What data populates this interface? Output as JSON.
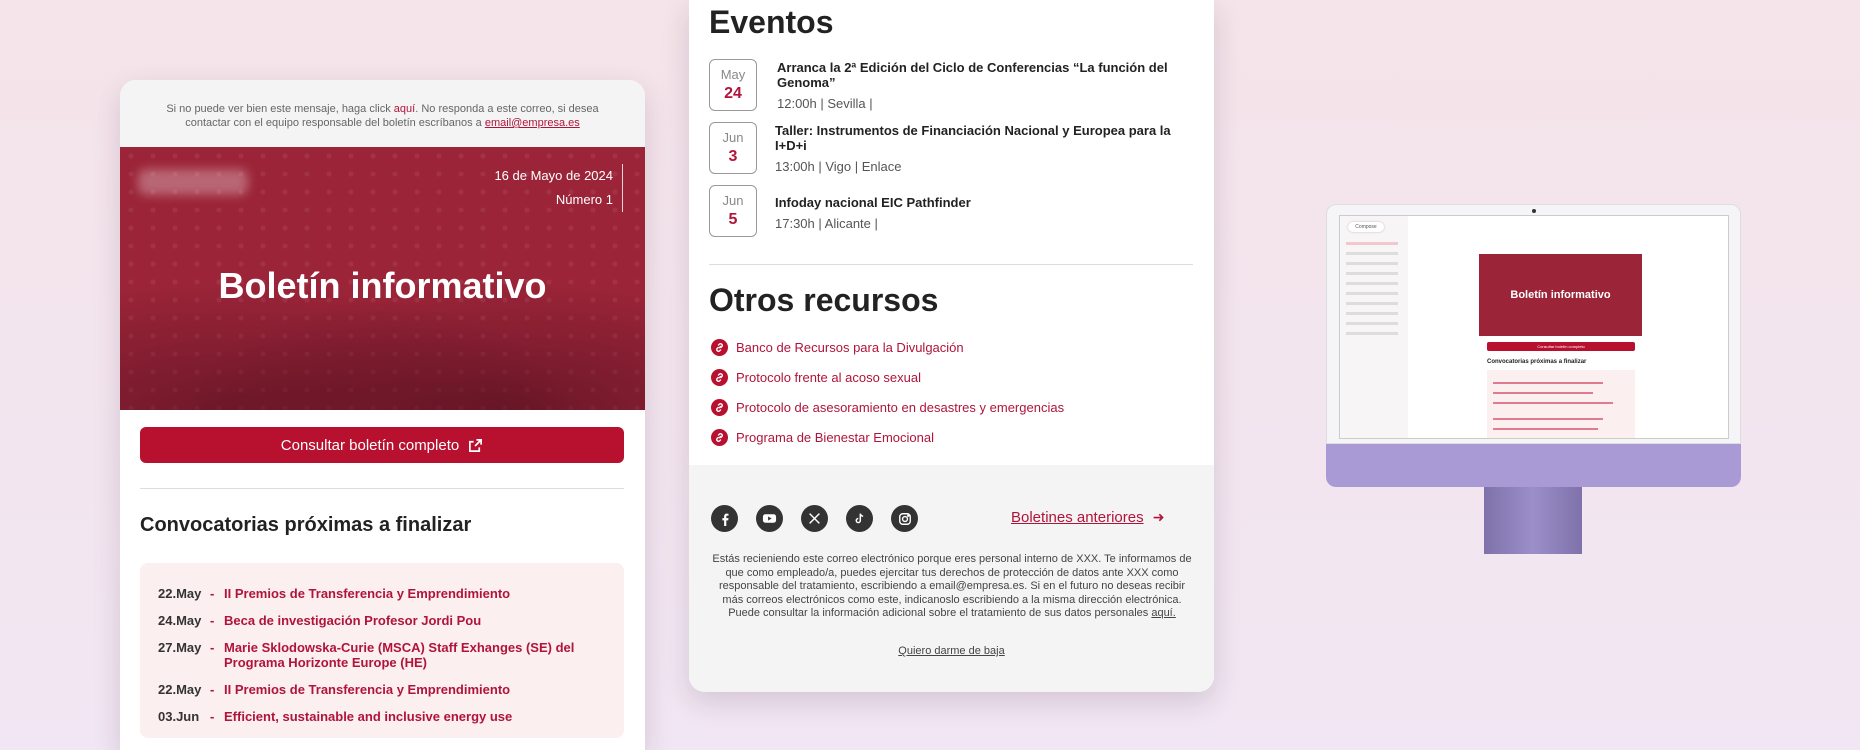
{
  "preheader": {
    "text_1": "Si no puede ver bien este mensaje, haga click ",
    "link_here": "aquí",
    "text_2": ". No responda a este correo, si desea contactar con el equipo responsable del boletín escríbanos a ",
    "email": "email@empresa.es"
  },
  "hero": {
    "date": "16 de Mayo de 2024",
    "number": "Número 1",
    "title": "Boletín informativo"
  },
  "cta": {
    "label": "Consultar boletín completo",
    "icon": "external-link-icon"
  },
  "convocatorias": {
    "heading": "Convocatorias próximas a finalizar",
    "separator": "-",
    "items": [
      {
        "date": "22.May",
        "title": "II Premios de Transferencia y Emprendimiento"
      },
      {
        "date": "24.May",
        "title": "Beca de investigación Profesor Jordi Pou"
      },
      {
        "date": "27.May",
        "title": "Marie Sklodowska-Curie (MSCA) Staff Exhanges (SE) del Programa Horizonte Europe (HE)"
      },
      {
        "date": "22.May",
        "title": "II Premios de Transferencia y Emprendimiento"
      },
      {
        "date": "03.Jun",
        "title": "Efficient, sustainable and inclusive energy use"
      }
    ]
  },
  "eventos": {
    "heading": "Eventos",
    "items": [
      {
        "month": "May",
        "day": "24",
        "title": "Arranca la 2ª Edición del Ciclo de Conferencias “La función del Genoma”",
        "info": "12:00h   |   Sevilla   |"
      },
      {
        "month": "Jun",
        "day": "3",
        "title": "Taller: Instrumentos de Financiación Nacional y Europea para la I+D+i",
        "info": "13:00h   |   Vigo   |   Enlace"
      },
      {
        "month": "Jun",
        "day": "5",
        "title": "Infoday nacional EIC Pathfinder",
        "info": "17:30h   |   Alicante   |"
      }
    ]
  },
  "recursos": {
    "heading": "Otros recursos",
    "icon": "link-icon",
    "items": [
      "Banco de Recursos para la Divulgación",
      "Protocolo frente al acoso sexual",
      "Protocolo de asesoramiento en desastres y emergencias",
      "Programa de Bienestar Emocional"
    ]
  },
  "footer": {
    "social": [
      "facebook-icon",
      "youtube-icon",
      "x-icon",
      "tiktok-icon",
      "instagram-icon"
    ],
    "previous": "Boletines anteriores",
    "legal": "Estás recieniendo este correo electrónico porque eres personal interno de XXX. Te informamos de que como empleado/a, puedes ejercitar tus derechos de protección de datos ante XXX como responsable del tratamiento, escribiendo a email@empresa.es. Si en el futuro no deseas recibir más correos electrónicos como este, indicanoslo escribiendo a la misma dirección electrónica. Puede consultar la información adicional sobre el tratamiento de sus datos personales ",
    "legal_link": "aquí.",
    "unsubscribe": "Quiero darme de baja"
  },
  "monitor": {
    "compose": "Compose",
    "newsletter_title": "Boletín informativo",
    "button": "Consultar boletín completo",
    "heading": "Convocatorias próximas a finalizar"
  },
  "colors": {
    "brand_red": "#b8102f",
    "hero_red": "#9b2438",
    "link_red": "#b0143a",
    "monitor_purple": "#a99ad6"
  }
}
